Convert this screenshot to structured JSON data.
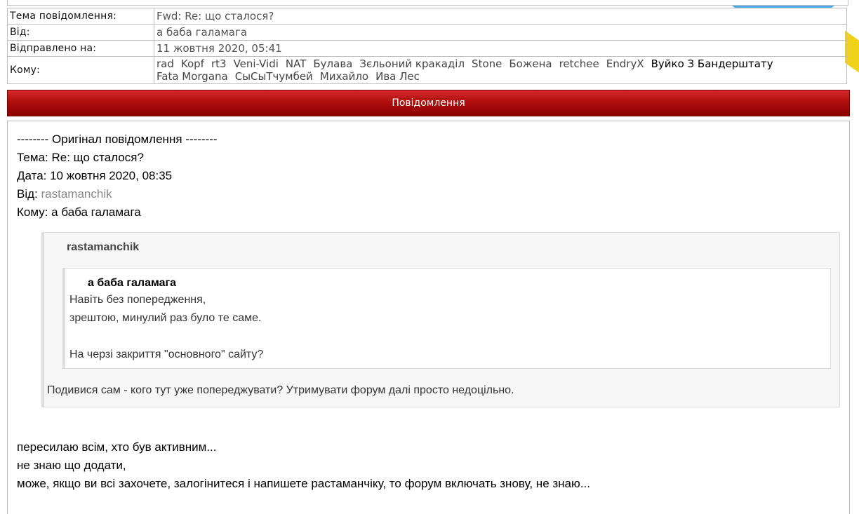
{
  "header": {
    "subject_label": "Тема повідомлення:",
    "subject_value": "Fwd: Re: що сталося?",
    "from_label": "Від:",
    "from_value": "а баба галамага",
    "sent_label": "Відправлено на:",
    "sent_value": "11 жовтня 2020, 05:41",
    "to_label": "Кому:",
    "recipients": [
      "rad",
      "Kopf",
      "rt3",
      "Veni-Vidi",
      "NAT",
      "Булава",
      "Зєльоний кракаділ",
      "Stone",
      "Божена",
      "retchee",
      "EndryX",
      "Вуйко З Бандерштату",
      "Fata Morgana",
      "СыСыТчумбей",
      "Михайло",
      "Ива Лес"
    ]
  },
  "message_bar": {
    "title": "Повідомлення"
  },
  "message": {
    "orig_header": "-------- Оригінал повідомлення --------",
    "subject_line": "Тема: Re: що сталося?",
    "date_line": "Дата: 10 жовтня 2020, 08:35",
    "from_prefix": "Від:",
    "from_name": "rastamanchik",
    "to_line": "Кому: а баба галамага",
    "quote": {
      "author": "rastamanchik",
      "inner_author": "а баба галамага",
      "inner_line1": "Навіть без попередження,",
      "inner_line2": "зрештою, минулий раз було те саме.",
      "inner_line3": "На черзі закриття \"основного\" сайту?",
      "reply": "Подивися сам - кого тут уже попереджувати? Утримувати форум далі просто недоцільно."
    },
    "tail_line1": "пересилаю всім, хто був активним...",
    "tail_line2": "не знаю що додати,",
    "tail_line3": "може, якщо ви всі захочете, залогінитеся і напишете растаманчіку, то форум включать знову, не знаю..."
  }
}
